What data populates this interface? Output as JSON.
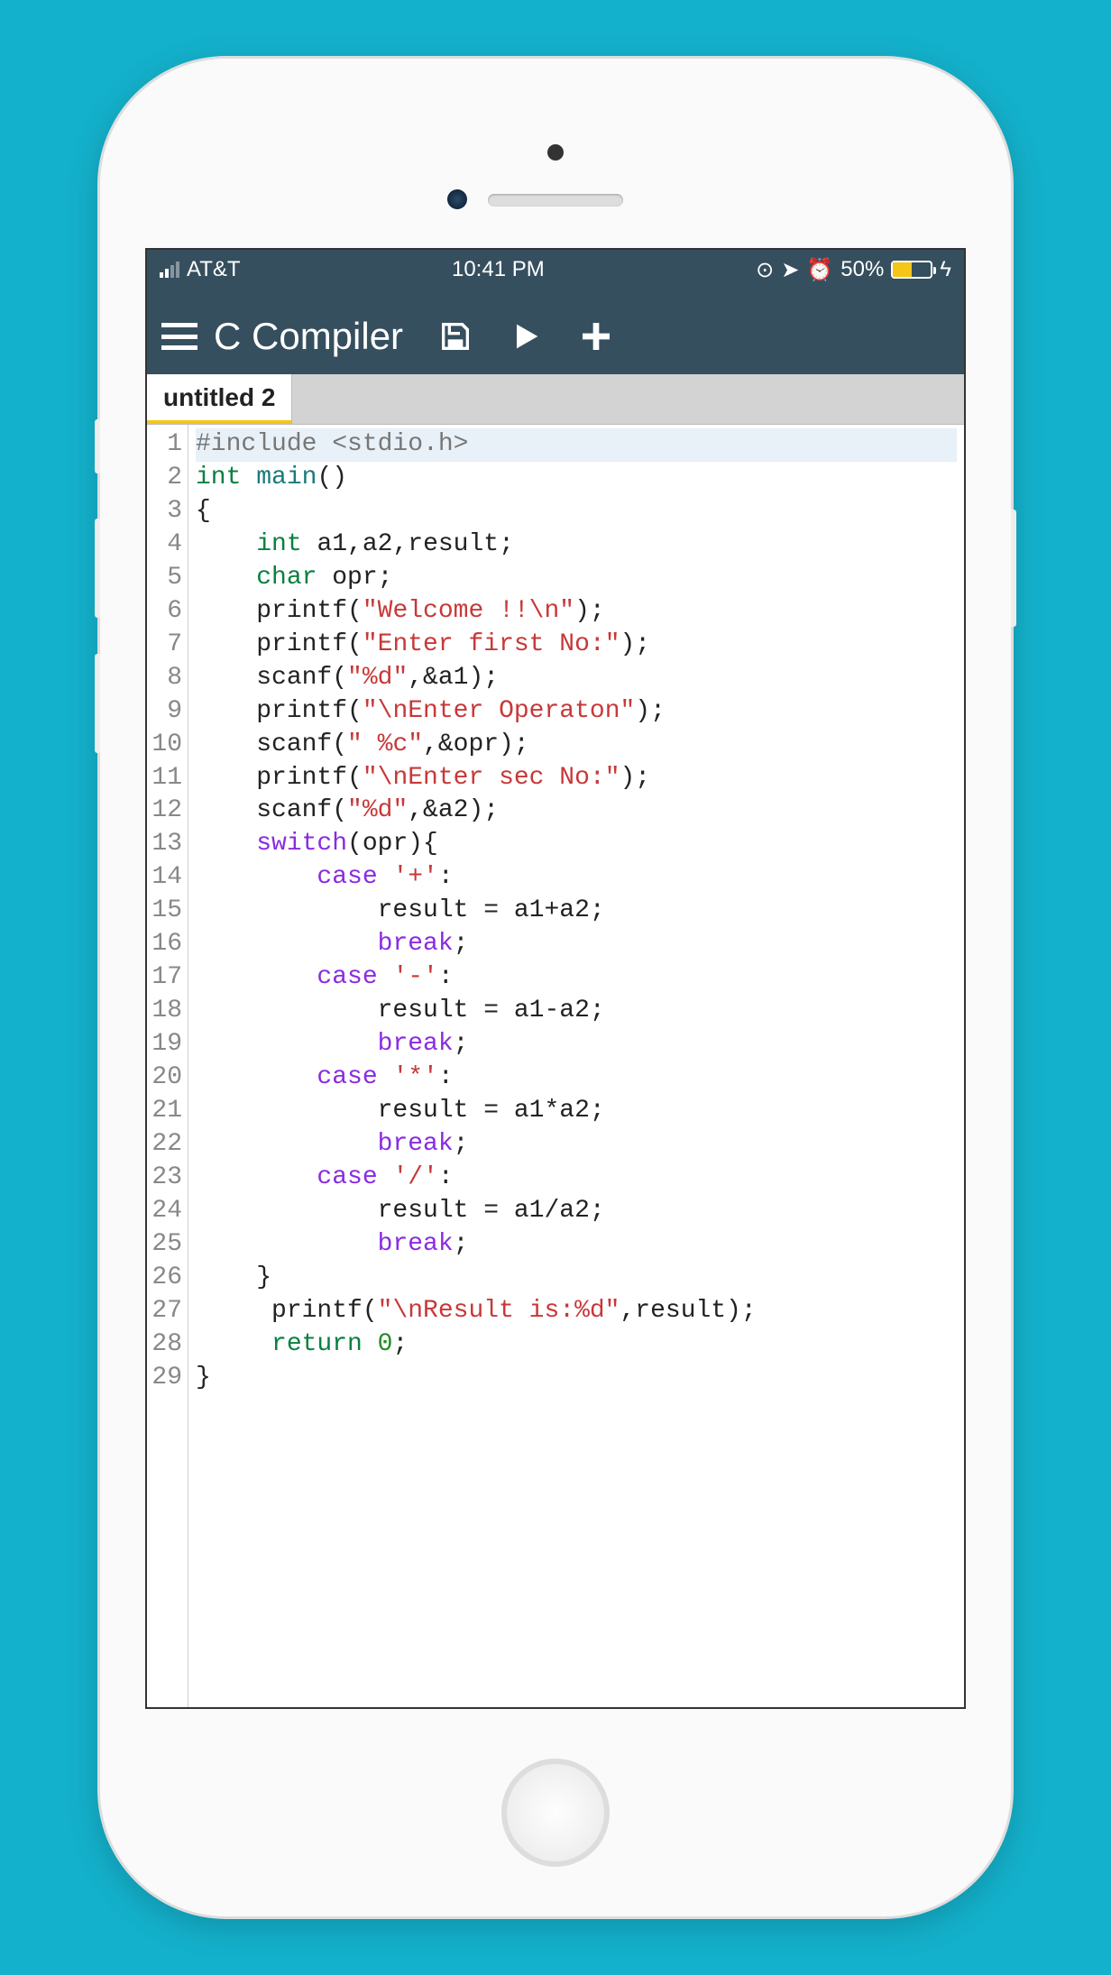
{
  "status": {
    "carrier": "AT&T",
    "time": "10:41 PM",
    "battery_pct": "50%",
    "icons": [
      "orientation-lock-icon",
      "location-icon",
      "alarm-icon"
    ]
  },
  "header": {
    "title": "C Compiler",
    "icons": {
      "save": "save-icon",
      "run": "play-icon",
      "add": "plus-icon"
    }
  },
  "tabs": [
    {
      "label": "untitled 2",
      "active": true
    }
  ],
  "code_lines": [
    {
      "n": 1,
      "highlight": true,
      "tokens": [
        [
          "pp",
          "#include <stdio.h>"
        ]
      ]
    },
    {
      "n": 2,
      "tokens": [
        [
          "type",
          "int"
        ],
        [
          "txt",
          " "
        ],
        [
          "fn",
          "main"
        ],
        [
          "txt",
          "()"
        ]
      ]
    },
    {
      "n": 3,
      "tokens": [
        [
          "txt",
          "{"
        ]
      ]
    },
    {
      "n": 4,
      "tokens": [
        [
          "txt",
          "    "
        ],
        [
          "type",
          "int"
        ],
        [
          "txt",
          " a1,a2,result;"
        ]
      ]
    },
    {
      "n": 5,
      "tokens": [
        [
          "txt",
          "    "
        ],
        [
          "type",
          "char"
        ],
        [
          "txt",
          " opr;"
        ]
      ]
    },
    {
      "n": 6,
      "tokens": [
        [
          "txt",
          "    printf("
        ],
        [
          "str",
          "\"Welcome !!\\n\""
        ],
        [
          "txt",
          ");"
        ]
      ]
    },
    {
      "n": 7,
      "tokens": [
        [
          "txt",
          "    printf("
        ],
        [
          "str",
          "\"Enter first No:\""
        ],
        [
          "txt",
          ");"
        ]
      ]
    },
    {
      "n": 8,
      "tokens": [
        [
          "txt",
          "    scanf("
        ],
        [
          "str",
          "\"%d\""
        ],
        [
          "txt",
          ",&a1);"
        ]
      ]
    },
    {
      "n": 9,
      "tokens": [
        [
          "txt",
          "    printf("
        ],
        [
          "str",
          "\"\\nEnter Operaton\""
        ],
        [
          "txt",
          ");"
        ]
      ]
    },
    {
      "n": 10,
      "tokens": [
        [
          "txt",
          "    scanf("
        ],
        [
          "str",
          "\" %c\""
        ],
        [
          "txt",
          ",&opr);"
        ]
      ]
    },
    {
      "n": 11,
      "tokens": [
        [
          "txt",
          "    printf("
        ],
        [
          "str",
          "\"\\nEnter sec No:\""
        ],
        [
          "txt",
          ");"
        ]
      ]
    },
    {
      "n": 12,
      "tokens": [
        [
          "txt",
          "    scanf("
        ],
        [
          "str",
          "\"%d\""
        ],
        [
          "txt",
          ",&a2);"
        ]
      ]
    },
    {
      "n": 13,
      "tokens": [
        [
          "txt",
          "    "
        ],
        [
          "flow",
          "switch"
        ],
        [
          "txt",
          "(opr){"
        ]
      ]
    },
    {
      "n": 14,
      "tokens": [
        [
          "txt",
          "        "
        ],
        [
          "flow",
          "case"
        ],
        [
          "txt",
          " "
        ],
        [
          "str",
          "'+'"
        ],
        [
          "txt",
          ":"
        ]
      ]
    },
    {
      "n": 15,
      "tokens": [
        [
          "txt",
          "            result = a1+a2;"
        ]
      ]
    },
    {
      "n": 16,
      "tokens": [
        [
          "txt",
          "            "
        ],
        [
          "flow",
          "break"
        ],
        [
          "txt",
          ";"
        ]
      ]
    },
    {
      "n": 17,
      "tokens": [
        [
          "txt",
          "        "
        ],
        [
          "flow",
          "case"
        ],
        [
          "txt",
          " "
        ],
        [
          "str",
          "'-'"
        ],
        [
          "txt",
          ":"
        ]
      ]
    },
    {
      "n": 18,
      "tokens": [
        [
          "txt",
          "            result = a1-a2;"
        ]
      ]
    },
    {
      "n": 19,
      "tokens": [
        [
          "txt",
          "            "
        ],
        [
          "flow",
          "break"
        ],
        [
          "txt",
          ";"
        ]
      ]
    },
    {
      "n": 20,
      "tokens": [
        [
          "txt",
          "        "
        ],
        [
          "flow",
          "case"
        ],
        [
          "txt",
          " "
        ],
        [
          "str",
          "'*'"
        ],
        [
          "txt",
          ":"
        ]
      ]
    },
    {
      "n": 21,
      "tokens": [
        [
          "txt",
          "            result = a1*a2;"
        ]
      ]
    },
    {
      "n": 22,
      "tokens": [
        [
          "txt",
          "            "
        ],
        [
          "flow",
          "break"
        ],
        [
          "txt",
          ";"
        ]
      ]
    },
    {
      "n": 23,
      "tokens": [
        [
          "txt",
          "        "
        ],
        [
          "flow",
          "case"
        ],
        [
          "txt",
          " "
        ],
        [
          "str",
          "'/'"
        ],
        [
          "txt",
          ":"
        ]
      ]
    },
    {
      "n": 24,
      "tokens": [
        [
          "txt",
          "            result = a1/a2;"
        ]
      ]
    },
    {
      "n": 25,
      "tokens": [
        [
          "txt",
          "            "
        ],
        [
          "flow",
          "break"
        ],
        [
          "txt",
          ";"
        ]
      ]
    },
    {
      "n": 26,
      "tokens": [
        [
          "txt",
          "    }"
        ]
      ]
    },
    {
      "n": 27,
      "tokens": [
        [
          "txt",
          "     printf("
        ],
        [
          "str",
          "\"\\nResult is:%d\""
        ],
        [
          "txt",
          ",result);"
        ]
      ]
    },
    {
      "n": 28,
      "tokens": [
        [
          "txt",
          "     "
        ],
        [
          "kw",
          "return"
        ],
        [
          "txt",
          " "
        ],
        [
          "num",
          "0"
        ],
        [
          "txt",
          ";"
        ]
      ]
    },
    {
      "n": 29,
      "tokens": [
        [
          "txt",
          "}"
        ]
      ]
    }
  ]
}
